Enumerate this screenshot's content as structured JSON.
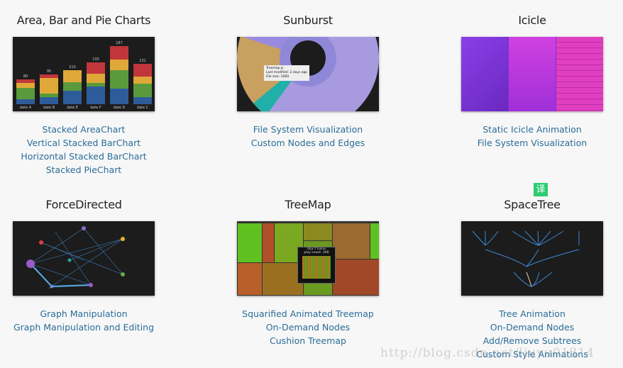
{
  "cards": [
    {
      "title": "Area, Bar and Pie Charts",
      "links": [
        "Stacked AreaChart",
        "Vertical Stacked BarChart",
        "Horizontal Stacked BarChart",
        "Stacked PieChart"
      ]
    },
    {
      "title": "Sunburst",
      "links": [
        "File System Visualization",
        "Custom Nodes and Edges"
      ]
    },
    {
      "title": "Icicle",
      "links": [
        "Static Icicle Animation",
        "File System Visualization"
      ]
    },
    {
      "title": "ForceDirected",
      "links": [
        "Graph Manipulation",
        "Graph Manipulation and Editing"
      ]
    },
    {
      "title": "TreeMap",
      "links": [
        "Squarified Animated Treemap",
        "On-Demand Nodes",
        "Cushion Treemap"
      ]
    },
    {
      "title": "SpaceTree",
      "links": [
        "Tree Animation",
        "On-Demand Nodes",
        "Add/Remove Subtrees",
        "Custom Style Animations"
      ]
    }
  ],
  "bar_thumb": {
    "labels": [
      "date A",
      "date B",
      "date E",
      "date F",
      "date D",
      "date C"
    ],
    "totals": [
      "80",
      "95",
      "110",
      "135",
      "187",
      "131"
    ],
    "colors": [
      "#2e5c9a",
      "#5a9a3c",
      "#e0a838",
      "#c0363a"
    ]
  },
  "sunburst_tooltip": {
    "name": "Treemap.js",
    "modified": "Last modified: 2 days ago",
    "size": "File size: 1069"
  },
  "treemap_tooltip": {
    "name": "Elja Y Gana",
    "plays": "play count: 266"
  },
  "badge": "译",
  "watermark": "http://blog.csdn.net/liuyu01314"
}
